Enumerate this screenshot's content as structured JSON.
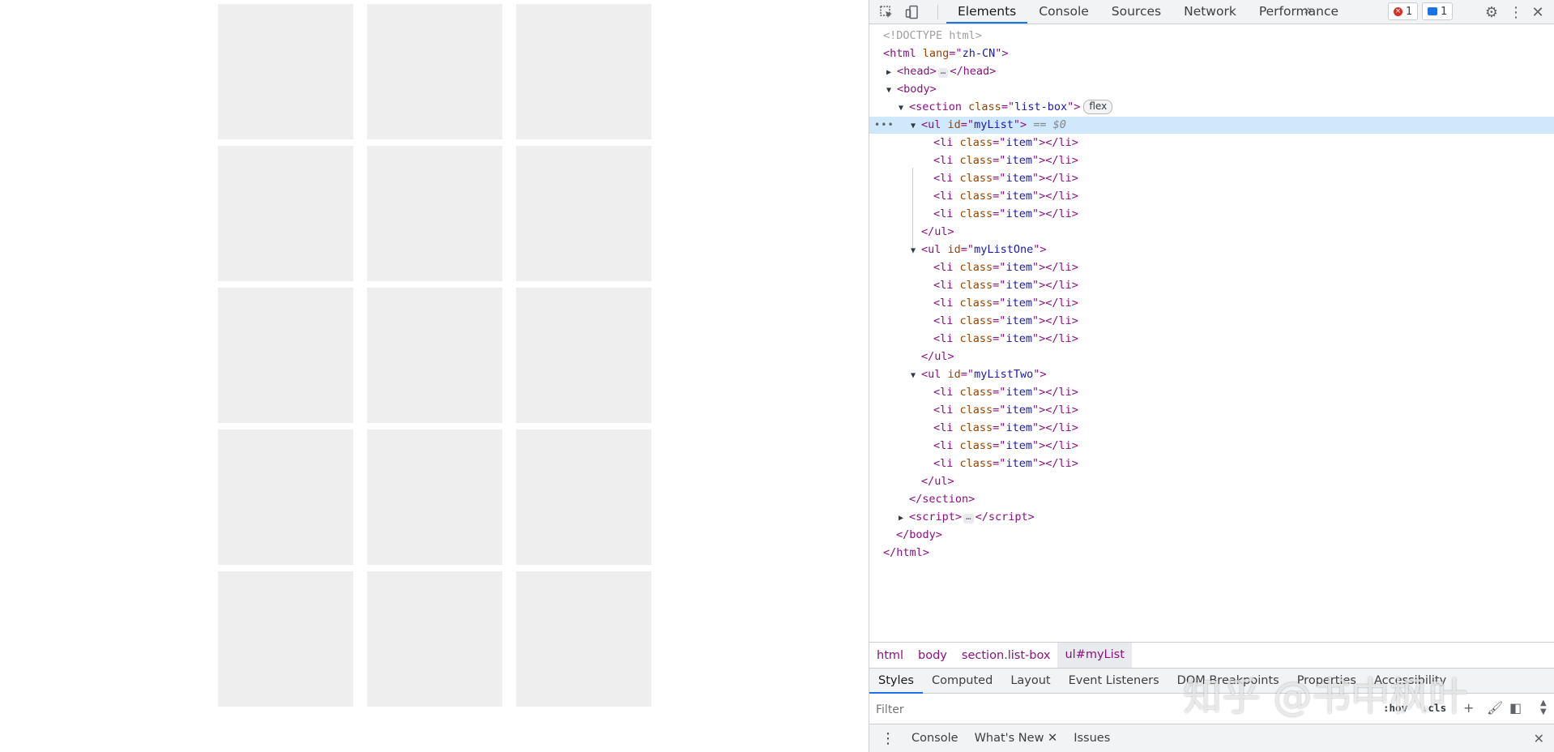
{
  "devtools": {
    "tabs": [
      "Elements",
      "Console",
      "Sources",
      "Network",
      "Performance"
    ],
    "active_tab": "Elements",
    "error_count": "1",
    "message_count": "1",
    "tree": {
      "doctype": "<!DOCTYPE html>",
      "html_lang": "zh-CN",
      "section_class": "list-box",
      "section_badge": "flex",
      "ul_ids": [
        "myList",
        "myListOne",
        "myListTwo"
      ],
      "selected_marker": "== $0",
      "li_class": "item"
    },
    "breadcrumbs": [
      "html",
      "body",
      "section.list-box",
      "ul#myList"
    ],
    "style_tabs": [
      "Styles",
      "Computed",
      "Layout",
      "Event Listeners",
      "DOM Breakpoints",
      "Properties",
      "Accessibility"
    ],
    "filter_placeholder": "Filter",
    "filter_toggles": [
      ":hov",
      ".cls"
    ],
    "drawer_tabs": [
      "Console",
      "What's New",
      "Issues"
    ],
    "watermark": "知乎 @书中枫叶"
  }
}
